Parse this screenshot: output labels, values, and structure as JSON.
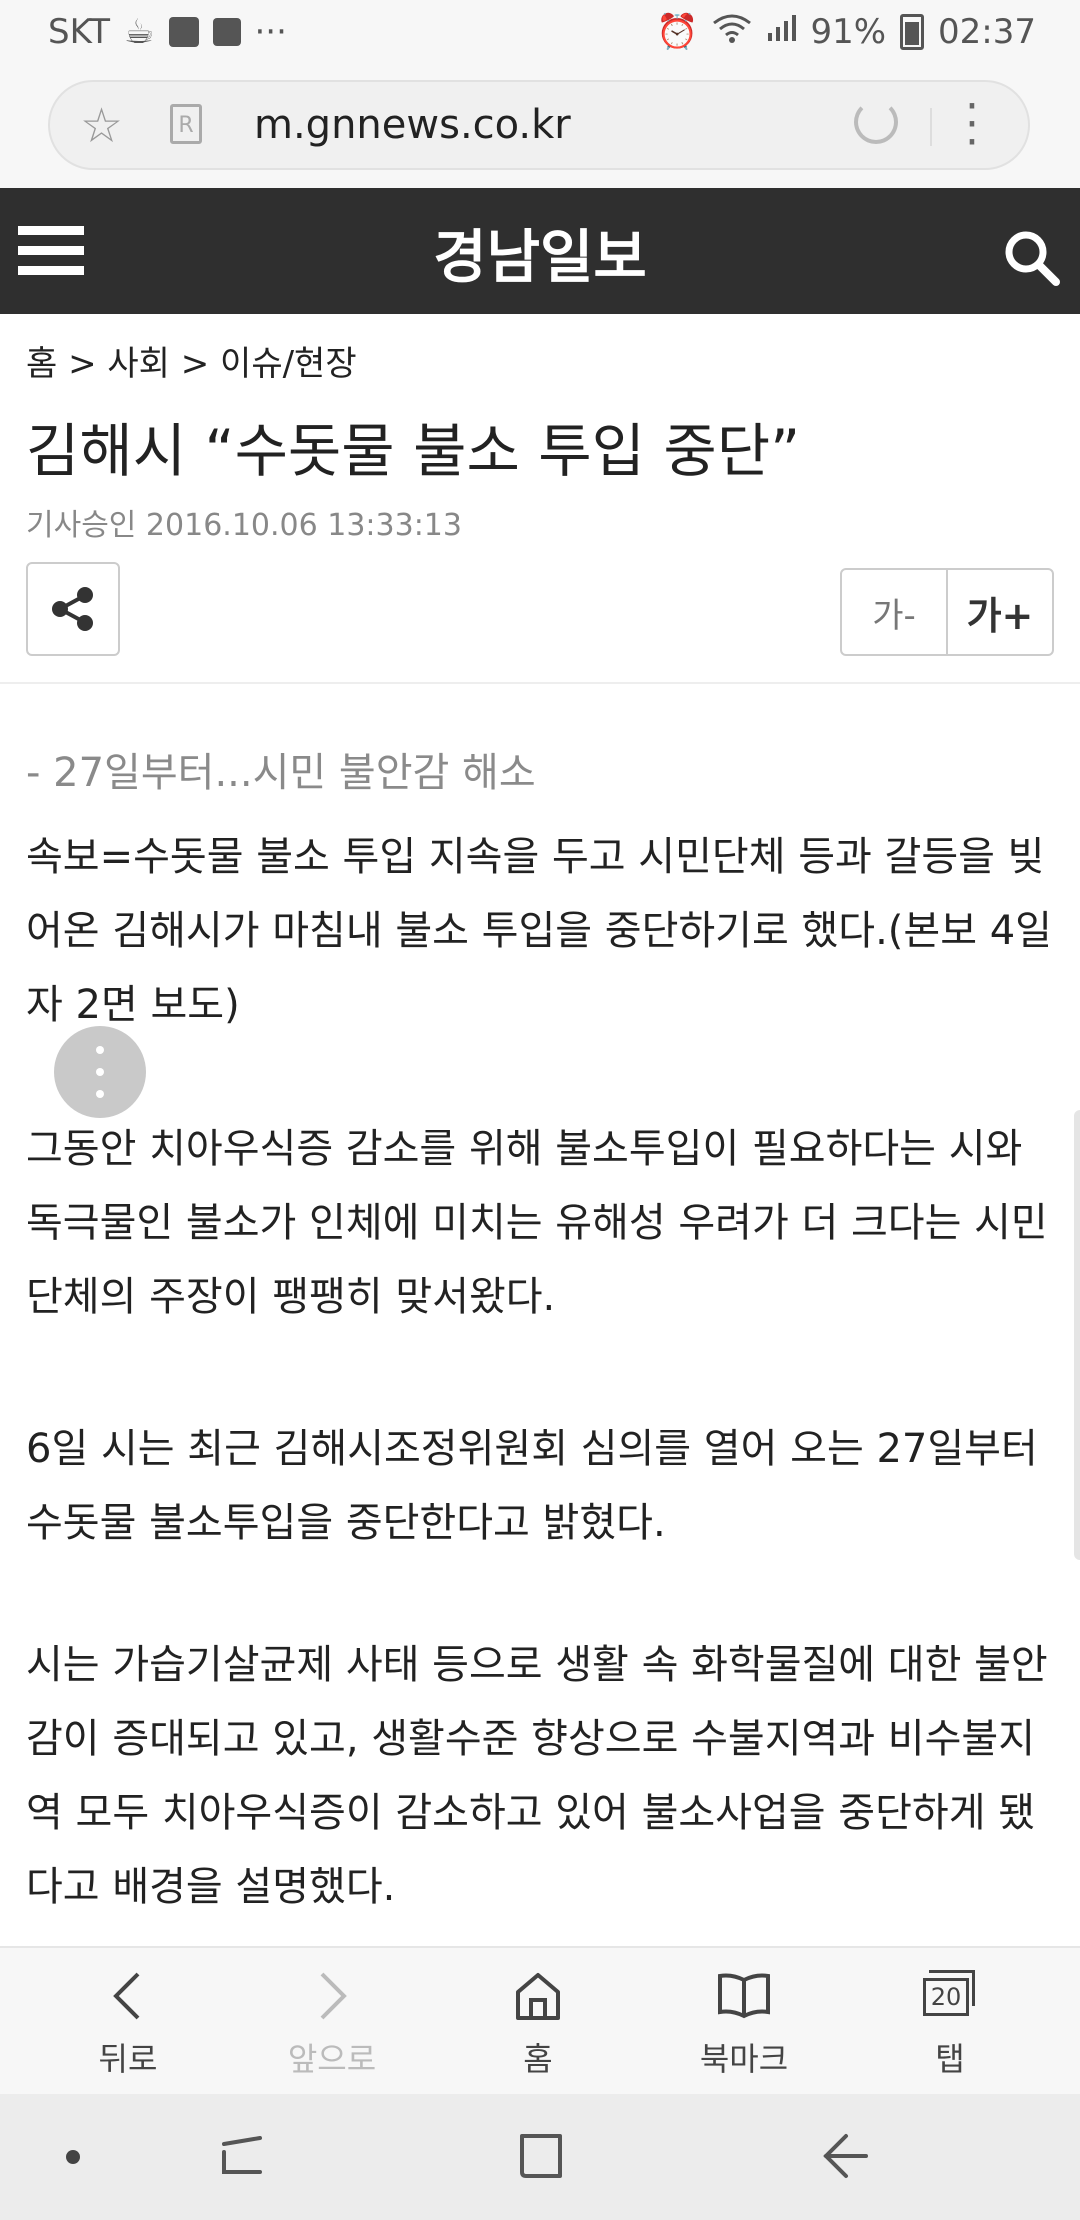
{
  "status_bar": {
    "carrier": "SKT",
    "battery": "91%",
    "time": "02:37"
  },
  "browser": {
    "url": "m.gnnews.co.kr",
    "reader_glyph": "R"
  },
  "site": {
    "logo": "경남일보"
  },
  "article": {
    "breadcrumb": "홈 > 사회 > 이슈/현장",
    "title": "김해시 “수돗물 불소 투입 중단”",
    "meta": "기사승인 2016.10.06  13:33:13",
    "font_minus": "가-",
    "font_plus": "가+",
    "subtitle": "- 27일부터...시민 불안감 해소",
    "paragraphs": [
      "속보=수돗물 불소 투입 지속을 두고 시민단체 등과 갈등을 빚어온 김해시가 마침내 불소 투입을 중단하기로 했다.(본보 4일자 2면 보도)",
      "그동안 치아우식증 감소를 위해 불소투입이 필요하다는 시와 독극물인 불소가 인체에 미치는 유해성 우려가 더 크다는 시민단체의 주장이 팽팽히 맞서왔다.",
      "6일 시는 최근 김해시조정위원회 심의를 열어 오는 27일부터 수돗물 불소투입을 중단한다고 밝혔다.",
      "시는 가습기살균제 사태 등으로 생활 속 화학물질에 대한 불안감이 증대되고 있고, 생활수준 향상으로 수불지역과 비수불지역 모두 치아우식증이 감소하고 있어 불소사업을 중단하게 됐다고 배경을 설명했다."
    ]
  },
  "toolbar": {
    "back": "뒤로",
    "forward": "앞으로",
    "home": "홈",
    "bookmark": "북마크",
    "tabs": "탭",
    "tab_count": "20"
  }
}
